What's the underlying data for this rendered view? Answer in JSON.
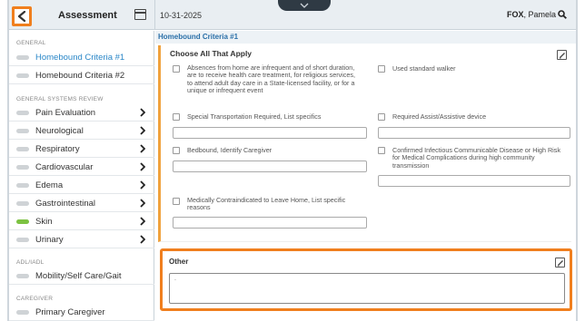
{
  "header": {
    "back_icon": "chevron-left-icon",
    "left_title": "Assessment",
    "calendar_icon": "calendar-icon",
    "date": "10-31-2025",
    "patient_last": "FOX",
    "patient_first": ", Pamela",
    "search_icon": "search-icon",
    "pull_down_icon": "chevron-down-icon"
  },
  "sidebar": {
    "sections": [
      {
        "header": "GENERAL"
      },
      {
        "header": "GENERAL SYSTEMS REVIEW"
      },
      {
        "header": "ADL/IADL"
      },
      {
        "header": "CAREGIVER"
      }
    ],
    "items": [
      {
        "label": "Homebound Criteria #1",
        "active": true,
        "status": "incomplete",
        "chevron": false
      },
      {
        "label": "Homebound Criteria #2",
        "active": false,
        "status": "incomplete",
        "chevron": false
      },
      {
        "label": "Pain Evaluation",
        "active": false,
        "status": "incomplete",
        "chevron": true
      },
      {
        "label": "Neurological",
        "active": false,
        "status": "incomplete",
        "chevron": true
      },
      {
        "label": "Respiratory",
        "active": false,
        "status": "incomplete",
        "chevron": true
      },
      {
        "label": "Cardiovascular",
        "active": false,
        "status": "incomplete",
        "chevron": true
      },
      {
        "label": "Edema",
        "active": false,
        "status": "incomplete",
        "chevron": true
      },
      {
        "label": "Gastrointestinal",
        "active": false,
        "status": "incomplete",
        "chevron": true
      },
      {
        "label": "Skin",
        "active": false,
        "status": "complete",
        "chevron": true
      },
      {
        "label": "Urinary",
        "active": false,
        "status": "incomplete",
        "chevron": true
      },
      {
        "label": "Mobility/Self Care/Gait",
        "active": false,
        "status": "incomplete",
        "chevron": false
      },
      {
        "label": "Primary Caregiver",
        "active": false,
        "status": "incomplete",
        "chevron": false
      }
    ]
  },
  "main": {
    "section_title": "Homebound Criteria #1",
    "card_title": "Choose All That Apply",
    "options": [
      {
        "label": "Absences from home are infrequent and of short duration, are to receive health care treatment, for religious services, to attend adult day care in a State-licensed facility, or for a unique or infrequent event",
        "checked": false
      },
      {
        "label": "Used standard walker",
        "checked": false
      },
      {
        "label": "Special Transportation Required, List specifics",
        "checked": false
      },
      {
        "label": "Required Assist/Assistive device",
        "checked": false
      },
      {
        "label": "Bedbound, Identify Caregiver",
        "checked": false
      },
      {
        "label": "Confirmed Infectious Communicable Disease or High Risk for Medical Complications during high community transmission",
        "checked": false
      },
      {
        "label": "Medically Contraindicated to Leave Home, List specific reasons",
        "checked": false
      }
    ],
    "other": {
      "title": "Other",
      "value": ".",
      "edit_icon": "edit-icon"
    }
  },
  "colors": {
    "accent_orange": "#f07f1e",
    "card_border": "#f0a23d",
    "active_link": "#2a87c8",
    "section_title": "#2a6fa8",
    "status_complete": "#7cc242",
    "status_incomplete": "#cfd3d6"
  }
}
